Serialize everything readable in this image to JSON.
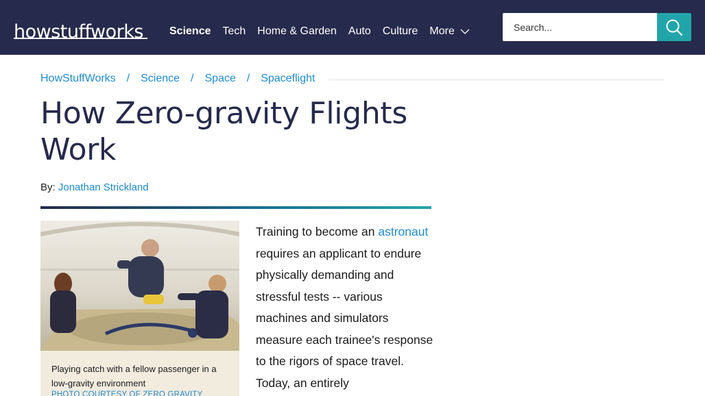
{
  "header": {
    "logo_text": "howstuffworks",
    "nav": [
      {
        "label": "Science",
        "active": true
      },
      {
        "label": "Tech",
        "active": false
      },
      {
        "label": "Home & Garden",
        "active": false
      },
      {
        "label": "Auto",
        "active": false
      },
      {
        "label": "Culture",
        "active": false
      }
    ],
    "more_label": "More",
    "search_placeholder": "Search...",
    "search_icon": "search-icon"
  },
  "breadcrumb": [
    "HowStuffWorks",
    "Science",
    "Space",
    "Spaceflight"
  ],
  "breadcrumb_separator": "/",
  "article": {
    "title": "How Zero-gravity Flights Work",
    "byline_prefix": "By:",
    "author": "Jonathan Strickland",
    "figure": {
      "caption": "Playing catch with a fellow passenger in a low-gravity environment",
      "credit": "PHOTO COURTESY OF ZERO GRAVITY"
    },
    "body": {
      "before_link": "Training to become an ",
      "link": "astronaut",
      "after_link": " requires an applicant to endure physically demanding and stressful tests -- various machines and simulators measure each trainee's response to the rigors of space travel. Today, an entirely"
    }
  },
  "colors": {
    "header_bg": "#262a4c",
    "accent_teal": "#22a5a9",
    "link_blue": "#1e8bd1",
    "title_navy": "#262a4c"
  }
}
